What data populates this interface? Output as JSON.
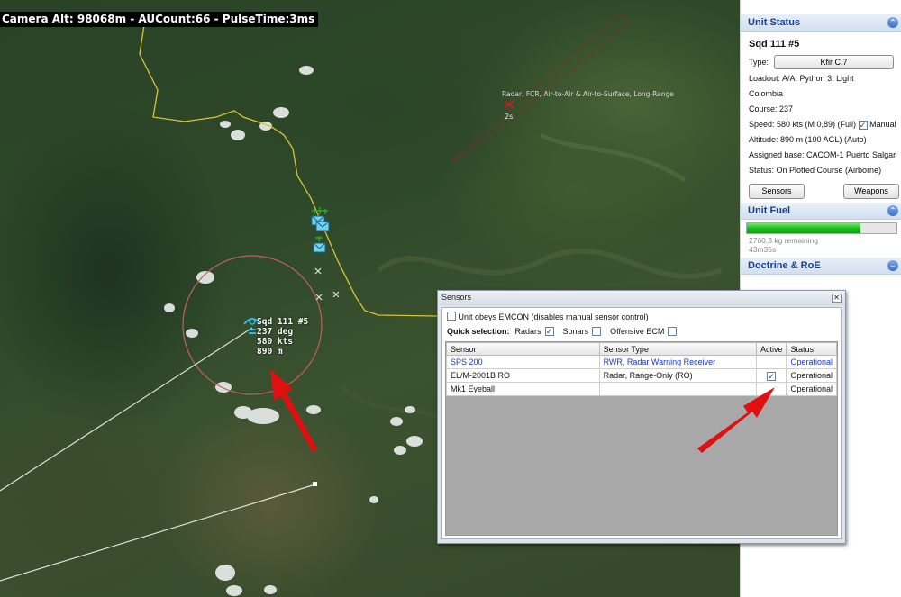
{
  "map": {
    "camera_readout": "Camera Alt: 98068m - AUCount:66 - PulseTime:3ms",
    "radar_contact": {
      "label": "Radar, FCR, Air-to-Air & Air-to-Surface, Long-Range",
      "time": "2s"
    },
    "unit_label": {
      "name": "Sqd 111 #5",
      "heading": "237 deg",
      "speed": "580 kts",
      "altitude": "890 m"
    },
    "colors": {
      "range_ring": "#c06060",
      "border_line": "#d8c23a",
      "arrow": "#e01010",
      "unit_icon": "#2fb7e6"
    }
  },
  "unit_status": {
    "header": "Unit Status",
    "name": "Sqd 111 #5",
    "type_label": "Type:",
    "type_value": "Kfir C.7",
    "loadout": "Loadout: A/A: Python 3, Light",
    "country": "Colombia",
    "course": "Course: 237",
    "speed": "Speed: 580 kts (M 0,89) (Full)",
    "manual_label": "Manual",
    "manual_checked": true,
    "altitude": "Altitude: 890 m (100 AGL)   (Auto)",
    "assigned_base": "Assigned base: CACOM-1 Puerto Salgar",
    "status": "Status: On Plotted Course (Airborne)",
    "sensors_button": "Sensors",
    "weapons_button": "Weapons"
  },
  "unit_fuel": {
    "header": "Unit Fuel",
    "fill_fraction": 0.76,
    "remaining": "2760,3 kg remaining",
    "time": "43m35s"
  },
  "doctrine": {
    "header": "Doctrine & RoE"
  },
  "sensors_dialog": {
    "title": "Sensors",
    "emcon_label": "Unit obeys EMCON (disables manual sensor control)",
    "quick_selection_label": "Quick selection:",
    "quick_radars": "Radars",
    "quick_sonars": "Sonars",
    "quick_ecm": "Offensive ECM",
    "columns": [
      "Sensor",
      "Sensor Type",
      "Active",
      "Status"
    ],
    "rows": [
      {
        "sensor": "SPS 200",
        "type": "RWR, Radar Warning Receiver",
        "active": false,
        "status": "Operational"
      },
      {
        "sensor": "EL/M-2001B RO",
        "type": "Radar, Range-Only (RO)",
        "active": true,
        "status": "Operational"
      },
      {
        "sensor": "Mk1 Eyeball",
        "type": "",
        "active": false,
        "status": "Operational"
      }
    ]
  }
}
